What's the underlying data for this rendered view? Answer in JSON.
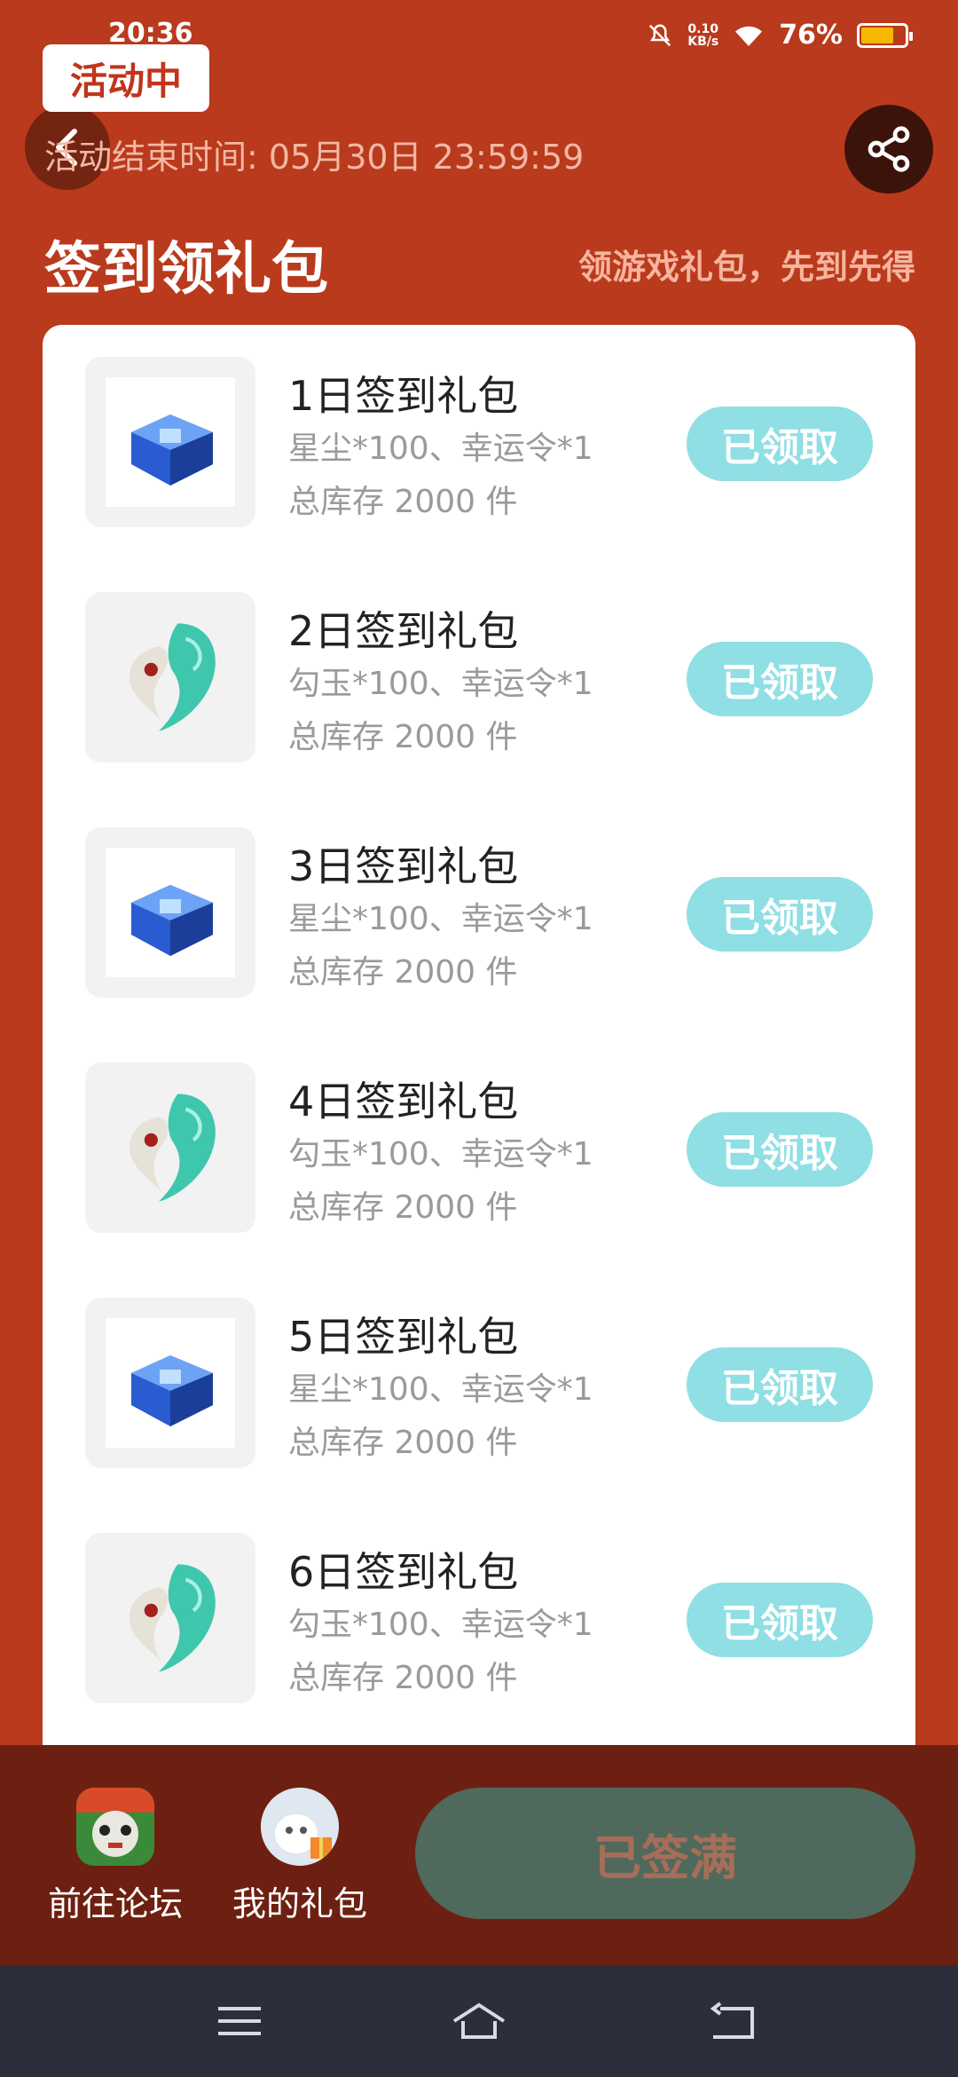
{
  "status_bar": {
    "time": "20:36",
    "net_speed_value": "0.10",
    "net_speed_unit": "KB/s",
    "battery": "76%",
    "battery_level": 0.76
  },
  "header": {
    "activity_badge": "活动中",
    "end_time": "活动结束时间: 05月30日 23:59:59",
    "section_title": "签到领礼包",
    "section_subtitle": "领游戏礼包，先到先得"
  },
  "gifts": [
    {
      "title": "1日签到礼包",
      "items": "星尘*100、幸运令*1",
      "stock": "总库存 2000 件",
      "button": "已领取",
      "icon": "blue-chest-icon"
    },
    {
      "title": "2日签到礼包",
      "items": "勾玉*100、幸运令*1",
      "stock": "总库存 2000 件",
      "button": "已领取",
      "icon": "magatama-icon"
    },
    {
      "title": "3日签到礼包",
      "items": "星尘*100、幸运令*1",
      "stock": "总库存 2000 件",
      "button": "已领取",
      "icon": "blue-chest-icon"
    },
    {
      "title": "4日签到礼包",
      "items": "勾玉*100、幸运令*1",
      "stock": "总库存 2000 件",
      "button": "已领取",
      "icon": "magatama-icon"
    },
    {
      "title": "5日签到礼包",
      "items": "星尘*100、幸运令*1",
      "stock": "总库存 2000 件",
      "button": "已领取",
      "icon": "blue-chest-icon"
    },
    {
      "title": "6日签到礼包",
      "items": "勾玉*100、幸运令*1",
      "stock": "总库存 2000 件",
      "button": "已领取",
      "icon": "magatama-icon"
    }
  ],
  "bottom": {
    "forum_label": "前往论坛",
    "gifts_label": "我的礼包",
    "signed_full": "已签满"
  },
  "colors": {
    "background": "#b93a1c",
    "claimed_button": "#8fdfe4",
    "signed_full_button": "#4f6a5c",
    "bottom_bar": "#6d2011",
    "nav_bar": "#2b2f3b"
  }
}
